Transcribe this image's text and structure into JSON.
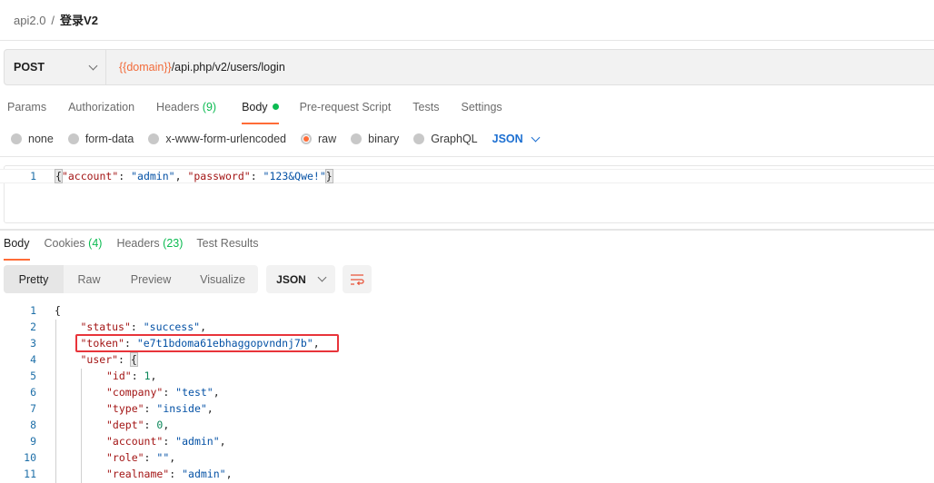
{
  "breadcrumb": {
    "collection": "api2.0",
    "separator": "/",
    "request": "登录V2"
  },
  "request": {
    "method": "POST",
    "url_var": "{{domain}}",
    "url_path": "/api.php/v2/users/login",
    "tabs": [
      {
        "label": "Params"
      },
      {
        "label": "Authorization"
      },
      {
        "label": "Headers",
        "count": "(9)"
      },
      {
        "label": "Body",
        "active": true,
        "dot": true
      },
      {
        "label": "Pre-request Script"
      },
      {
        "label": "Tests"
      },
      {
        "label": "Settings"
      }
    ],
    "body_types": [
      {
        "label": "none"
      },
      {
        "label": "form-data"
      },
      {
        "label": "x-www-form-urlencoded"
      },
      {
        "label": "raw",
        "selected": true
      },
      {
        "label": "binary"
      },
      {
        "label": "GraphQL"
      }
    ],
    "language": "JSON",
    "body_lines": [
      {
        "num": "1",
        "indent": 0,
        "tokens": [
          [
            "brace",
            "{"
          ],
          [
            "k",
            "\"account\""
          ],
          [
            "p",
            ": "
          ],
          [
            "s",
            "\"admin\""
          ],
          [
            "p",
            ", "
          ],
          [
            "k",
            "\"password\""
          ],
          [
            "p",
            ": "
          ],
          [
            "s",
            "\"123&Qwe!\""
          ],
          [
            "brace",
            "}"
          ]
        ]
      }
    ]
  },
  "response": {
    "tabs": [
      {
        "label": "Body",
        "active": true
      },
      {
        "label": "Cookies",
        "count": "(4)"
      },
      {
        "label": "Headers",
        "count": "(23)"
      },
      {
        "label": "Test Results"
      }
    ],
    "views": [
      "Pretty",
      "Raw",
      "Preview",
      "Visualize"
    ],
    "active_view": "Pretty",
    "format": "JSON",
    "lines": [
      {
        "num": "1",
        "indent": 0,
        "tokens": [
          [
            "p",
            "{"
          ]
        ]
      },
      {
        "num": "2",
        "indent": 1,
        "tokens": [
          [
            "k",
            "\"status\""
          ],
          [
            "p",
            ": "
          ],
          [
            "s",
            "\"success\""
          ],
          [
            "p",
            ","
          ]
        ]
      },
      {
        "num": "3",
        "indent": 1,
        "highlight": true,
        "tokens": [
          [
            "k",
            "\"token\""
          ],
          [
            "p",
            ": "
          ],
          [
            "s",
            "\"e7t1bdoma61ebhaggopvndnj7b\""
          ],
          [
            "p",
            ","
          ]
        ]
      },
      {
        "num": "4",
        "indent": 1,
        "tokens": [
          [
            "k",
            "\"user\""
          ],
          [
            "p",
            ": "
          ],
          [
            "brace",
            "{"
          ]
        ]
      },
      {
        "num": "5",
        "indent": 2,
        "tokens": [
          [
            "k",
            "\"id\""
          ],
          [
            "p",
            ": "
          ],
          [
            "n",
            "1"
          ],
          [
            "p",
            ","
          ]
        ]
      },
      {
        "num": "6",
        "indent": 2,
        "tokens": [
          [
            "k",
            "\"company\""
          ],
          [
            "p",
            ": "
          ],
          [
            "s",
            "\"test\""
          ],
          [
            "p",
            ","
          ]
        ]
      },
      {
        "num": "7",
        "indent": 2,
        "tokens": [
          [
            "k",
            "\"type\""
          ],
          [
            "p",
            ": "
          ],
          [
            "s",
            "\"inside\""
          ],
          [
            "p",
            ","
          ]
        ]
      },
      {
        "num": "8",
        "indent": 2,
        "tokens": [
          [
            "k",
            "\"dept\""
          ],
          [
            "p",
            ": "
          ],
          [
            "n",
            "0"
          ],
          [
            "p",
            ","
          ]
        ]
      },
      {
        "num": "9",
        "indent": 2,
        "tokens": [
          [
            "k",
            "\"account\""
          ],
          [
            "p",
            ": "
          ],
          [
            "s",
            "\"admin\""
          ],
          [
            "p",
            ","
          ]
        ]
      },
      {
        "num": "10",
        "indent": 2,
        "tokens": [
          [
            "k",
            "\"role\""
          ],
          [
            "p",
            ": "
          ],
          [
            "s",
            "\"\""
          ],
          [
            "p",
            ","
          ]
        ]
      },
      {
        "num": "11",
        "indent": 2,
        "tokens": [
          [
            "k",
            "\"realname\""
          ],
          [
            "p",
            ": "
          ],
          [
            "s",
            "\"admin\""
          ],
          [
            "p",
            ","
          ]
        ]
      }
    ]
  },
  "colors": {
    "accent": "#ff6c37",
    "success": "#0cbb52",
    "key": "#a31515",
    "string": "#0451a5",
    "number": "#098658",
    "highlight_box": "#e8343a"
  }
}
